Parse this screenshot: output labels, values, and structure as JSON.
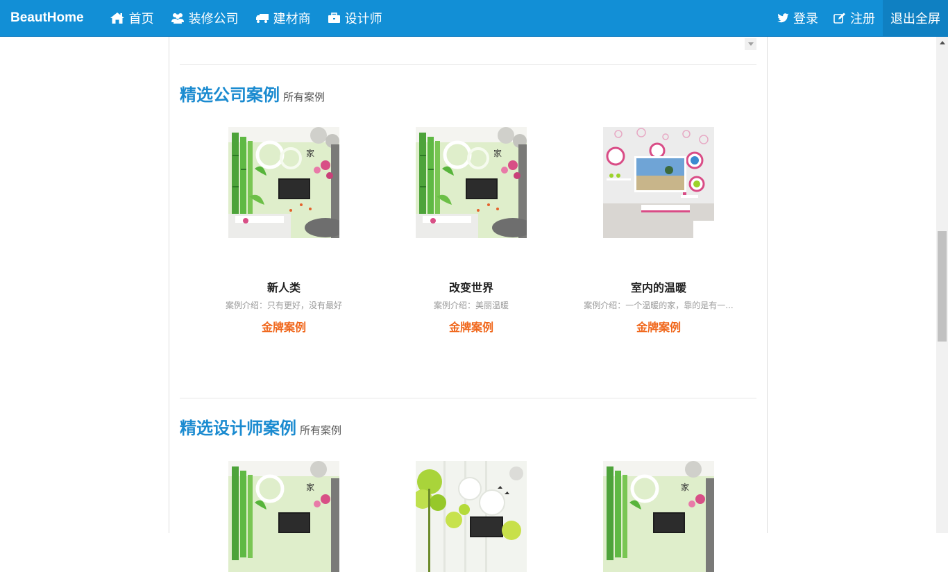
{
  "nav": {
    "brand": "BeautHome",
    "items": [
      {
        "label": "首页",
        "icon": "home-icon"
      },
      {
        "label": "装修公司",
        "icon": "users-icon"
      },
      {
        "label": "建材商",
        "icon": "truck-icon"
      },
      {
        "label": "设计师",
        "icon": "briefcase-icon"
      }
    ],
    "right": [
      {
        "label": "登录",
        "icon": "twitter-icon"
      },
      {
        "label": "注册",
        "icon": "edit-icon"
      },
      {
        "label": "退出全屏"
      }
    ]
  },
  "company_section": {
    "title": "精选公司案例",
    "more": "所有案例",
    "cards": [
      {
        "name": "新人类",
        "desc": "案例介绍：只有更好，没有最好",
        "badge": "金牌案例",
        "image": "bamboo-wall-image"
      },
      {
        "name": "改变世界",
        "desc": "案例介绍：美丽温暖",
        "badge": "金牌案例",
        "image": "bamboo-wall-image"
      },
      {
        "name": "室内的温暖",
        "desc": "案例介绍：一个温暖的家，靠的是有一...",
        "badge": "金牌案例",
        "image": "circles-wall-image"
      }
    ]
  },
  "designer_section": {
    "title": "精选设计师案例",
    "more": "所有案例",
    "cards": [
      {
        "image": "bamboo-wall-image"
      },
      {
        "image": "green-tree-wall-image"
      },
      {
        "image": "bamboo-wall-image"
      }
    ]
  },
  "colors": {
    "navbar": "#128fd6",
    "accent_title": "#1b8bd0",
    "badge": "#f0661a"
  }
}
